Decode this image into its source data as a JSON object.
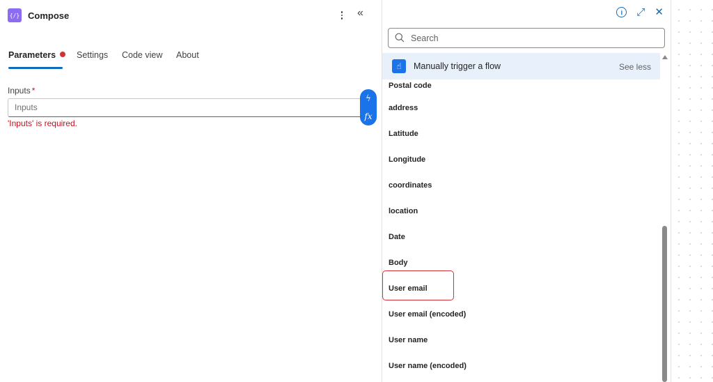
{
  "header": {
    "title": "Compose",
    "icon_glyph": "{/}",
    "menu_icon": "more-vertical-icon",
    "collapse_glyph": "«"
  },
  "tabs": [
    {
      "label": "Parameters",
      "active": true,
      "has_error": true
    },
    {
      "label": "Settings",
      "active": false
    },
    {
      "label": "Code view",
      "active": false
    },
    {
      "label": "About",
      "active": false
    }
  ],
  "inputs_field": {
    "label": "Inputs",
    "required_mark": "*",
    "placeholder": "Inputs",
    "value": "",
    "error": "'Inputs' is required."
  },
  "insert_pill": {
    "dynamic_glyph": "ϟ",
    "expression_glyph": "fx"
  },
  "flyout": {
    "info_glyph": "i",
    "expand_glyph": "⤢",
    "close_glyph": "✕",
    "search": {
      "placeholder": "Search",
      "value": ""
    },
    "trigger": {
      "icon_glyph": "☝",
      "label": "Manually trigger a flow",
      "toggle_label": "See less"
    },
    "items": [
      "Postal code",
      "address",
      "Latitude",
      "Longitude",
      "coordinates",
      "location",
      "Date",
      "Body",
      "User email",
      "User email (encoded)",
      "User name",
      "User name (encoded)"
    ],
    "highlighted_item": "User email"
  },
  "colors": {
    "accent": "#0f6cbd",
    "error": "#c50f1f",
    "trigger_bg": "#e8f0fb",
    "compose_icon": "#8c6cf0"
  }
}
